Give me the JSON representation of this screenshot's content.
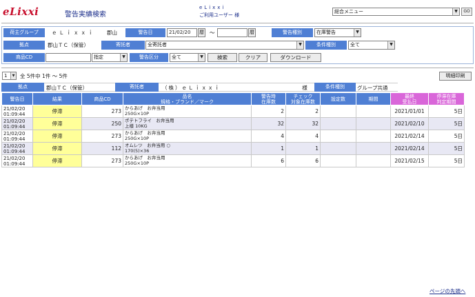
{
  "header": {
    "logo": "eLixxi",
    "title": "警告実績検索",
    "user_name": "eLixxi",
    "user_suffix": "ご利用ユーザー 様",
    "menu_value": "総合メニュー",
    "go_label": "GO"
  },
  "search": {
    "row1": {
      "owner_group_label": "荷主グループ",
      "owner_group_value": "ｅＬｉｘｘｉ",
      "owner_group_area": "郡山",
      "warn_date_label": "警告日",
      "warn_date_from": "21/02/20",
      "cal_label": "暦",
      "range_sep": "～",
      "warn_date_to": "",
      "warn_type_label": "警告種別",
      "warn_type_value": "在庫警告"
    },
    "row2": {
      "base_label": "拠点",
      "base_value": "郡山ＴＣ（保管）",
      "consignor_label": "寄託者",
      "consignor_value": "全寄託者",
      "cond_type_label": "条件種別",
      "cond_type_value": "全て"
    },
    "row3": {
      "item_cd_label": "商品CD",
      "item_cd_value": "",
      "match_value": "指定",
      "warn_class_label": "警告区分",
      "warn_class_value": "全て",
      "search_btn": "検索",
      "clear_btn": "クリア",
      "download_btn": "ダウンロード"
    }
  },
  "paging": {
    "page_value": "1",
    "info": "全 5件中 1件 ～ 5件",
    "print_btn": "明細印刷"
  },
  "summary": {
    "base_label": "拠点",
    "base_value": "郡山ＴＣ（保管）",
    "consignor_label": "寄託者",
    "consignor_value": "（株）ｅＬｉｘｘｉ",
    "consignor_suffix": "様",
    "cond_type_label": "条件種別",
    "cond_type_value": "グループ共通"
  },
  "table": {
    "headers": {
      "date": "警告日",
      "result": "結果",
      "item_cd": "商品CD",
      "name1": "品名",
      "name2": "規格・ブランド／マーク",
      "stock1": "警告時",
      "stock2": "在庫数",
      "check1": "チェック",
      "check2": "対象在庫数",
      "setting": "設定数",
      "period": "期間",
      "last1": "最終",
      "last2": "受払日",
      "stag1": "停滞在庫",
      "stag2": "判定期間"
    },
    "rows": [
      {
        "date": "21/02/20",
        "time": "01:09:44",
        "result": "停滞",
        "item_cd": "273",
        "name": "からあげ　お弁当用",
        "spec": "250G×10P",
        "stock": "2",
        "check": "2",
        "setting": "",
        "period": "",
        "last": "2021/01/01",
        "stag": "5日"
      },
      {
        "date": "21/02/20",
        "time": "01:09:44",
        "result": "停滞",
        "item_cd": "250",
        "name": "ポテトフライ　お弁当用",
        "spec": "上様 10KG",
        "stock": "32",
        "check": "32",
        "setting": "",
        "period": "",
        "last": "2021/02/10",
        "stag": "5日"
      },
      {
        "date": "21/02/20",
        "time": "01:09:44",
        "result": "停滞",
        "item_cd": "273",
        "name": "からあげ　お弁当用",
        "spec": "250G×10P",
        "stock": "4",
        "check": "4",
        "setting": "",
        "period": "",
        "last": "2021/02/14",
        "stag": "5日"
      },
      {
        "date": "21/02/20",
        "time": "01:09:44",
        "result": "停滞",
        "item_cd": "112",
        "name": "オムレツ　お弁当用 ○",
        "spec": "170(5)×36",
        "stock": "1",
        "check": "1",
        "setting": "",
        "period": "",
        "last": "2021/02/14",
        "stag": "5日"
      },
      {
        "date": "21/02/20",
        "time": "01:09:44",
        "result": "停滞",
        "item_cd": "273",
        "name": "からあげ　お弁当用",
        "spec": "250G×10P",
        "stock": "6",
        "check": "6",
        "setting": "",
        "period": "",
        "last": "2021/02/15",
        "stag": "5日"
      }
    ]
  },
  "footer": {
    "top_link": "ページの先頭へ"
  }
}
